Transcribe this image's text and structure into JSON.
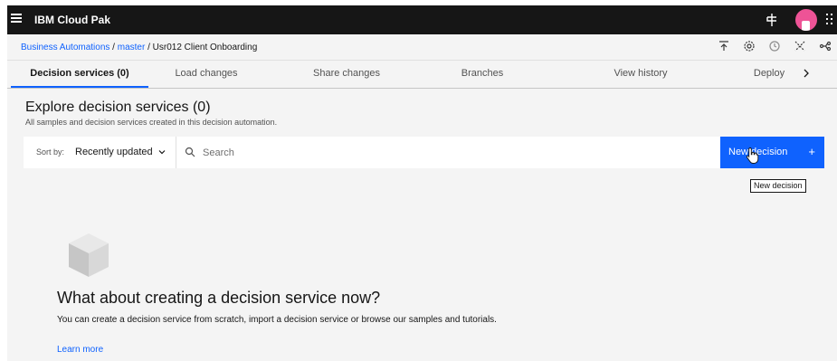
{
  "topbar": {
    "brand": "IBM Cloud Pak"
  },
  "breadcrumb": {
    "link1": "Business Automations",
    "sep1": " / ",
    "link2": "master",
    "sep2": " / ",
    "current": "Usr012 Client Onboarding",
    "icons": [
      "upload-icon",
      "settings-icon",
      "history-icon",
      "refresh-icon",
      "share-icon"
    ]
  },
  "tabs": [
    {
      "label": "Decision services (0)"
    },
    {
      "label": "Load changes"
    },
    {
      "label": "Share changes"
    },
    {
      "label": "Branches"
    },
    {
      "label": "View history"
    },
    {
      "label": "Deploy"
    }
  ],
  "main": {
    "title": "Explore decision services (0)",
    "subtitle": "All samples and decision services created in this decision automation.",
    "sort_label": "Sort by:",
    "sort_value": "Recently updated",
    "search_placeholder": "Search",
    "new_button": "New decision",
    "new_button_plus": "+",
    "tooltip": "New decision",
    "empty_title": "What about creating a decision service now?",
    "empty_text": "You can create a decision service from scratch, import a decision service or browse our samples and tutorials.",
    "learn_more": "Learn more"
  },
  "colors": {
    "accent": "#0f62fe",
    "header": "#161616",
    "avatar": "#ee5396"
  }
}
